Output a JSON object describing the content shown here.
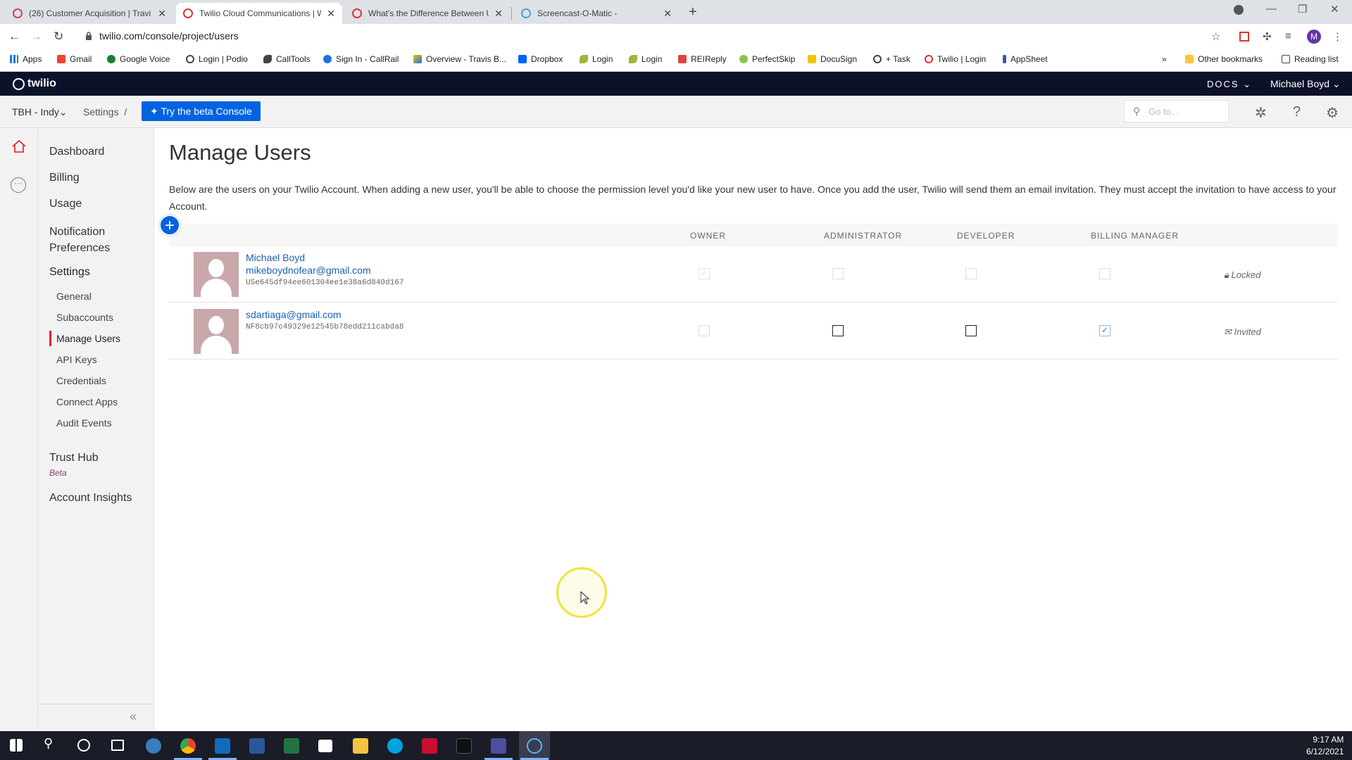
{
  "browser": {
    "tabs": [
      {
        "title": "(26) Customer Acquisition | Travi",
        "active": false
      },
      {
        "title": "Twilio Cloud Communications | W",
        "active": true
      },
      {
        "title": "What's the Difference Between U",
        "active": false
      },
      {
        "title": "Screencast-O-Matic -",
        "active": false
      }
    ],
    "url": "twilio.com/console/project/users",
    "profile_initial": "M",
    "bookmarks": [
      "Apps",
      "Gmail",
      "Google Voice",
      "Login | Podio",
      "CallTools",
      "Sign In - CallRail",
      "Overview - Travis B...",
      "Dropbox",
      "Login",
      "Login",
      "REIReply",
      "PerfectSkip",
      "DocuSign",
      "+ Task",
      "Twilio | Login",
      "AppSheet"
    ],
    "other_bookmarks": "Other bookmarks",
    "reading_list": "Reading list",
    "overflow": "»"
  },
  "twilio": {
    "logo": "twilio",
    "docs": "DOCS",
    "user": "Michael Boyd",
    "project": "TBH - Indy",
    "breadcrumb": "Settings",
    "breadcrumb_sep": "/",
    "beta_button": "Try the beta Console",
    "search_placeholder": "Go to..."
  },
  "sidebar": {
    "items": [
      {
        "label": "Dashboard"
      },
      {
        "label": "Billing"
      },
      {
        "label": "Usage"
      },
      {
        "label": "Notification Preferences"
      },
      {
        "label": "Settings"
      }
    ],
    "settings_items": [
      {
        "label": "General"
      },
      {
        "label": "Subaccounts"
      },
      {
        "label": "Manage Users"
      },
      {
        "label": "API Keys"
      },
      {
        "label": "Credentials"
      },
      {
        "label": "Connect Apps"
      },
      {
        "label": "Audit Events"
      }
    ],
    "trust_hub": "Trust Hub",
    "trust_hub_badge": "Beta",
    "account_insights": "Account Insights",
    "collapse": "«"
  },
  "main": {
    "title": "Manage Users",
    "description": "Below are the users on your Twilio Account. When adding a new user, you'll be able to choose the permission level you'd like your new user to have. Once you add the user, Twilio will send them an email invitation. They must accept the invitation to have access to your Account.",
    "add_button": "+",
    "columns": [
      "OWNER",
      "ADMINISTRATOR",
      "DEVELOPER",
      "BILLING MANAGER"
    ],
    "users": [
      {
        "name": "Michael Boyd",
        "email": "mikeboydnofear@gmail.com",
        "sid": "USe645df94ee601304ee1e38a6d840d167",
        "status": "Locked",
        "roles": {
          "owner": true,
          "administrator": false,
          "developer": false,
          "billing_manager": false
        },
        "disabled": true
      },
      {
        "name": "",
        "email": "sdartiaga@gmail.com",
        "sid": "NF8cb97c49329e12545b78edd211cabda8",
        "status": "Invited",
        "roles": {
          "owner": false,
          "administrator": false,
          "developer": false,
          "billing_manager": true
        },
        "disabled": false
      }
    ]
  },
  "taskbar": {
    "time": "9:17 AM",
    "date": "6/12/2021"
  },
  "colors": {
    "twilio_dark": "#0d122b",
    "primary_blue": "#0263e0",
    "twilio_red": "#e31e26",
    "link_blue": "#1a5fb4"
  }
}
